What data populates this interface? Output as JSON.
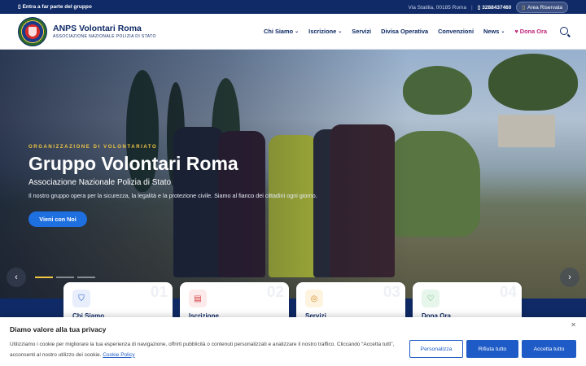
{
  "topbar": {
    "join_link": "Entra a far parte del gruppo",
    "address": "Via Statilia, 00185 Roma",
    "separator": "|",
    "phone": "3288437460",
    "reserved_area": "Area Riservata"
  },
  "header": {
    "brand_title": "ANPS Volontari Roma",
    "brand_subtitle": "ASSOCIAZIONE NAZIONALE POLIZIA DI STATO",
    "nav": [
      {
        "label": "Chi Siamo",
        "dropdown": true
      },
      {
        "label": "Iscrizione",
        "dropdown": true
      },
      {
        "label": "Servizi",
        "dropdown": false
      },
      {
        "label": "Divisa Operativa",
        "dropdown": false
      },
      {
        "label": "Convenzioni",
        "dropdown": false
      },
      {
        "label": "News",
        "dropdown": true
      }
    ],
    "donate_label": "Dona Ora"
  },
  "hero": {
    "eyebrow": "ORGANIZZAZIONE DI VOLONTARIATO",
    "title": "Gruppo Volontari Roma",
    "subtitle": "Associazione Nazionale Polizia di Stato",
    "description": "Il nostro gruppo opera per la sicurezza, la legalità e la protezione civile. Siamo al fianco dei cittadini ogni giorno.",
    "cta_label": "Vieni con Noi",
    "active_slide": 1,
    "slide_count": 3
  },
  "cards": [
    {
      "number": "01",
      "title": "Chi Siamo",
      "icon": "shield-icon",
      "icon_bg": "#e8eefb",
      "icon_color": "#1e5bc6"
    },
    {
      "number": "02",
      "title": "Iscrizione",
      "icon": "document-icon",
      "icon_bg": "#fdeaea",
      "icon_color": "#d33a3a"
    },
    {
      "number": "03",
      "title": "Servizi",
      "icon": "support-icon",
      "icon_bg": "#fdf3df",
      "icon_color": "#d7902a"
    },
    {
      "number": "04",
      "title": "Dona Ora",
      "icon": "heart-icon",
      "icon_bg": "#e6f6ea",
      "icon_color": "#2c9a4c"
    }
  ],
  "cookie": {
    "title": "Diamo valore alla tua privacy",
    "text": "Utilizziamo i cookie per migliorare la tua esperienza di navigazione, offrirti pubblicità o contenuti personalizzati e analizzare il nostro traffico. Cliccando “Accetta tutti”, acconsenti al nostro utilizzo dei cookie.",
    "link": "Cookie Policy",
    "customize": "Personalizza",
    "reject": "Rifiuta tutto",
    "accept": "Accetta tutto"
  },
  "colors": {
    "navy": "#0f2a66",
    "accent_blue": "#1e6fe0",
    "gold": "#f2c744",
    "donate": "#c0267a"
  }
}
